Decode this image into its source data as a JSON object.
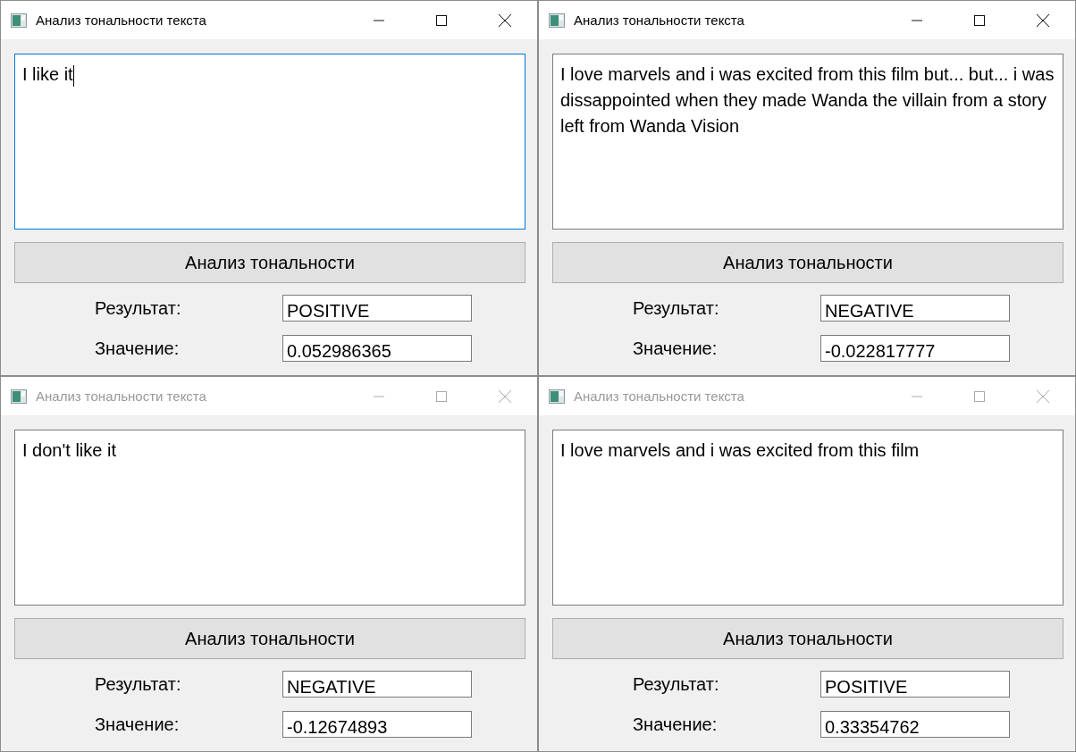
{
  "windows": [
    {
      "title": "Анализ тональности текста",
      "active": true,
      "text": "I like it",
      "focused": true,
      "button": "Анализ тональности",
      "result_label": "Результат:",
      "result": "POSITIVE",
      "value_label": "Значение:",
      "value": "0.052986365"
    },
    {
      "title": "Анализ тональности текста",
      "active": true,
      "text": "I love marvels and i was excited from this film but... but... i was dissappointed when they made Wanda the villain from a story left from Wanda Vision",
      "focused": false,
      "button": "Анализ тональности",
      "result_label": "Результат:",
      "result": "NEGATIVE",
      "value_label": "Значение:",
      "value": "-0.022817777"
    },
    {
      "title": "Анализ тональности текста",
      "active": false,
      "text": "I don't like it",
      "focused": false,
      "button": "Анализ тональности",
      "result_label": "Результат:",
      "result": "NEGATIVE",
      "value_label": "Значение:",
      "value": "-0.12674893"
    },
    {
      "title": "Анализ тональности текста",
      "active": false,
      "text": "I love marvels and i was excited from this film",
      "focused": false,
      "button": "Анализ тональности",
      "result_label": "Результат:",
      "result": "POSITIVE",
      "value_label": "Значение:",
      "value": "0.33354762"
    }
  ]
}
